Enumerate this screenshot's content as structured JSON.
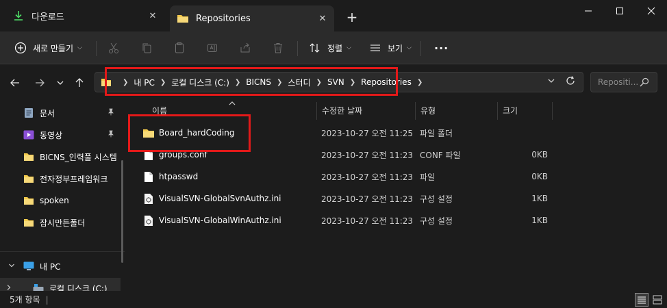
{
  "tabs": [
    {
      "label": "다운로드",
      "icon": "download-icon",
      "active": false
    },
    {
      "label": "Repositories",
      "icon": "folder-icon",
      "active": true
    }
  ],
  "toolbar": {
    "new_label": "새로 만들기",
    "sort_label": "정렬",
    "view_label": "보기",
    "more_label": "···"
  },
  "breadcrumb": [
    "내 PC",
    "로컬 디스크 (C:)",
    "BICNS",
    "스터디",
    "SVN",
    "Repositories"
  ],
  "search": {
    "placeholder": "Repositi..."
  },
  "sidebar": {
    "items": [
      {
        "label": "문서",
        "icon": "documents-icon",
        "pinned": true
      },
      {
        "label": "동영상",
        "icon": "videos-icon",
        "pinned": true
      },
      {
        "label": "BICNS_인력풀 시스템",
        "icon": "folder-icon",
        "pinned": false
      },
      {
        "label": "전자정부프레임워크",
        "icon": "folder-icon",
        "pinned": false
      },
      {
        "label": "spoken",
        "icon": "folder-icon",
        "pinned": false
      },
      {
        "label": "잠시만든폴더",
        "icon": "folder-icon",
        "pinned": false
      },
      {
        "label": "내 PC",
        "icon": "pc-icon",
        "pinned": false
      },
      {
        "label": "로컬 디스크 (C:)",
        "icon": "drive-icon",
        "pinned": false
      }
    ]
  },
  "columns": {
    "name": "이름",
    "date": "수정한 날짜",
    "type": "유형",
    "size": "크기"
  },
  "files": [
    {
      "name": "Board_hardCoding",
      "date": "2023-10-27 오전 11:25",
      "type": "파일 폴더",
      "size": "",
      "icon": "folder-icon"
    },
    {
      "name": "groups.conf",
      "date": "2023-10-27 오전 11:23",
      "type": "CONF 파일",
      "size": "0KB",
      "icon": "file-icon"
    },
    {
      "name": "htpasswd",
      "date": "2023-10-27 오전 11:23",
      "type": "파일",
      "size": "0KB",
      "icon": "file-icon"
    },
    {
      "name": "VisualSVN-GlobalSvnAuthz.ini",
      "date": "2023-10-27 오전 11:23",
      "type": "구성 설정",
      "size": "1KB",
      "icon": "settings-file-icon"
    },
    {
      "name": "VisualSVN-GlobalWinAuthz.ini",
      "date": "2023-10-27 오전 11:23",
      "type": "구성 설정",
      "size": "1KB",
      "icon": "settings-file-icon"
    }
  ],
  "status": {
    "item_count": "5개 항목"
  },
  "colors": {
    "background": "#1c1c1c",
    "toolbar": "#2b2b2b",
    "folder": "#f2c94c",
    "highlight": "#e31919",
    "accent": "#4cc2ff"
  }
}
